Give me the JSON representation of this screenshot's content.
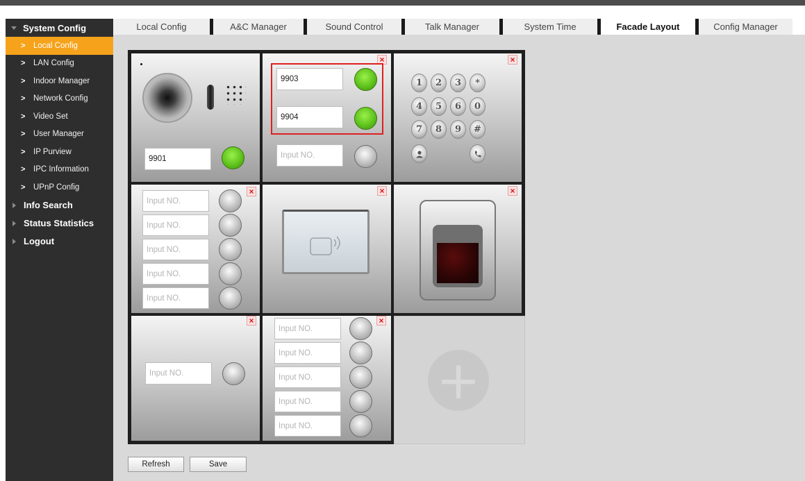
{
  "sidebar": {
    "sections": [
      {
        "label": "System Config",
        "expanded": true,
        "items": [
          {
            "label": "Local Config",
            "active": true
          },
          {
            "label": "LAN Config"
          },
          {
            "label": "Indoor Manager"
          },
          {
            "label": "Network Config"
          },
          {
            "label": "Video Set"
          },
          {
            "label": "User Manager"
          },
          {
            "label": "IP Purview"
          },
          {
            "label": "IPC Information"
          },
          {
            "label": "UPnP Config"
          }
        ]
      },
      {
        "label": "Info Search"
      },
      {
        "label": "Status Statistics"
      },
      {
        "label": "Logout"
      }
    ]
  },
  "tabs": [
    {
      "label": "Local Config"
    },
    {
      "label": "A&C Manager"
    },
    {
      "label": "Sound Control"
    },
    {
      "label": "Talk Manager"
    },
    {
      "label": "System Time"
    },
    {
      "label": "Facade Layout",
      "active": true
    },
    {
      "label": "Config Manager"
    }
  ],
  "facade": {
    "camera_module": {
      "number": "9901"
    },
    "two_button_module": {
      "numbers": [
        "9903",
        "9904"
      ],
      "extra_placeholder": "Input NO."
    },
    "keypad_module": {
      "keys": [
        "1",
        "2",
        "3",
        "*",
        "4",
        "5",
        "6",
        "0",
        "7",
        "8",
        "9",
        "#"
      ]
    },
    "five_button_module_left": {
      "placeholders": [
        "Input NO.",
        "Input NO.",
        "Input NO.",
        "Input NO.",
        "Input NO."
      ]
    },
    "single_button_module": {
      "placeholder": "Input NO."
    },
    "five_button_module_right": {
      "placeholders": [
        "Input NO.",
        "Input NO.",
        "Input NO.",
        "Input NO.",
        "Input NO."
      ]
    },
    "delete_symbol": "×",
    "add_symbol": "+"
  },
  "colors": {
    "accent": "#f6a31b",
    "active_button": "#5fc31c",
    "highlight_box": "#e02020",
    "sidebar_bg": "#2e2e2e",
    "content_bg": "#d9d9d9"
  },
  "actions": {
    "refresh_label": "Refresh",
    "save_label": "Save"
  }
}
